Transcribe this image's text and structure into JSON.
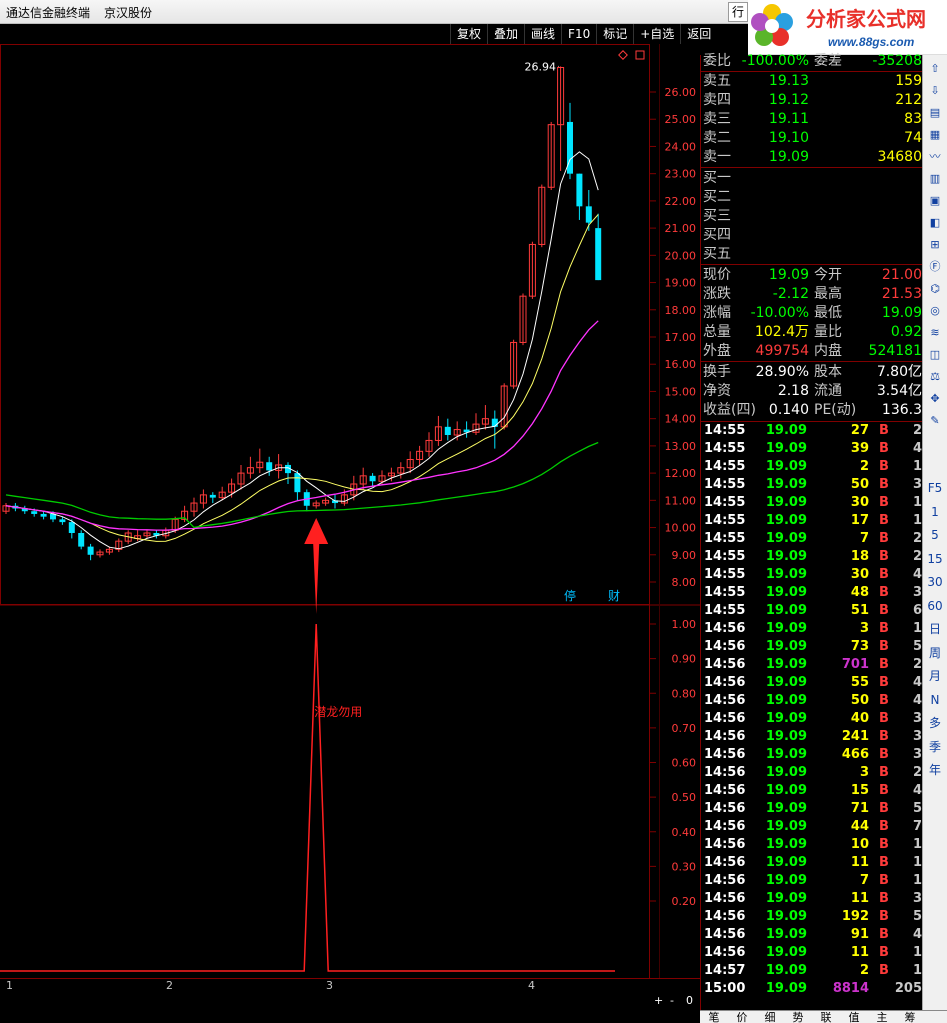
{
  "window": {
    "app_title": "通达信金融终端",
    "stock_name": "京汉股份",
    "menu_label": "行"
  },
  "logo": {
    "name": "分析家公式网",
    "url": "www.88gs.com"
  },
  "toolbar": [
    "复权",
    "叠加",
    "画线",
    "F10",
    "标记",
    "+自选",
    "返回"
  ],
  "chart": {
    "y_ticks": [
      "26.00",
      "25.00",
      "24.00",
      "23.00",
      "22.00",
      "21.00",
      "20.00",
      "19.00",
      "18.00",
      "17.00",
      "16.00",
      "15.00",
      "14.00",
      "13.00",
      "12.00",
      "11.00",
      "10.00",
      "9.00",
      "8.00"
    ],
    "y_values": [
      26,
      25,
      24,
      23,
      22,
      21,
      20,
      19,
      18,
      17,
      16,
      15,
      14,
      13,
      12,
      11,
      10,
      9,
      8
    ],
    "peak_label": "26.94",
    "peak_value": 26.94,
    "badges": [
      "停",
      "财"
    ],
    "ind_ticks": [
      "1.00",
      "0.90",
      "0.80",
      "0.70",
      "0.60",
      "0.50",
      "0.40",
      "0.30",
      "0.20"
    ],
    "ind_values": [
      1.0,
      0.9,
      0.8,
      0.7,
      0.6,
      0.5,
      0.4,
      0.3,
      0.2
    ],
    "signal_label": "潜龙勿用",
    "date_labels": [
      "1",
      "2",
      "3",
      "4"
    ],
    "colors": {
      "up": "#ff3b3b",
      "down": "#00e5ff",
      "ma5": "#ffffff",
      "ma10": "#ffff66",
      "ma20": "#ff33ff",
      "ma60": "#00cc00",
      "grid": "#800000",
      "signal": "#ff2020"
    }
  },
  "zoom": {
    "plus": "+",
    "minus": "-",
    "value": "0"
  },
  "quote": {
    "weibi": {
      "label": "委比",
      "value": "-100.00%",
      "label2": "委差",
      "value2": "-35208"
    },
    "asks": [
      {
        "label": "卖五",
        "price": "19.13",
        "vol": "159"
      },
      {
        "label": "卖四",
        "price": "19.12",
        "vol": "212"
      },
      {
        "label": "卖三",
        "price": "19.11",
        "vol": "83"
      },
      {
        "label": "卖二",
        "price": "19.10",
        "vol": "74"
      },
      {
        "label": "卖一",
        "price": "19.09",
        "vol": "34680"
      }
    ],
    "bids": [
      "买一",
      "买二",
      "买三",
      "买四",
      "买五"
    ],
    "stats": [
      {
        "l1": "现价",
        "v1": "19.09",
        "c1": "#00ff00",
        "l2": "今开",
        "v2": "21.00",
        "c2": "#ff3b3b"
      },
      {
        "l1": "涨跌",
        "v1": "-2.12",
        "c1": "#00ff00",
        "l2": "最高",
        "v2": "21.53",
        "c2": "#ff3b3b"
      },
      {
        "l1": "涨幅",
        "v1": "-10.00%",
        "c1": "#00ff00",
        "l2": "最低",
        "v2": "19.09",
        "c2": "#00ff00"
      },
      {
        "l1": "总量",
        "v1": "102.4万",
        "c1": "#ffff00",
        "l2": "量比",
        "v2": "0.92",
        "c2": "#00ff00"
      },
      {
        "l1": "外盘",
        "v1": "499754",
        "c1": "#ff3b3b",
        "l2": "内盘",
        "v2": "524181",
        "c2": "#00ff00"
      }
    ],
    "stats2": [
      {
        "l1": "换手",
        "v1": "28.90%",
        "l2": "股本",
        "v2": "7.80亿"
      },
      {
        "l1": "净资",
        "v1": "2.18",
        "l2": "流通",
        "v2": "3.54亿"
      },
      {
        "l1": "收益(四)",
        "v1": "0.140",
        "l2": "PE(动)",
        "v2": "136.3"
      }
    ]
  },
  "ticks": [
    {
      "t": "14:55",
      "p": "19.09",
      "n": "27",
      "nc": "#ffff00",
      "b": "B",
      "c": "2"
    },
    {
      "t": "14:55",
      "p": "19.09",
      "n": "39",
      "nc": "#ffff00",
      "b": "B",
      "c": "4"
    },
    {
      "t": "14:55",
      "p": "19.09",
      "n": "2",
      "nc": "#ffff00",
      "b": "B",
      "c": "1"
    },
    {
      "t": "14:55",
      "p": "19.09",
      "n": "50",
      "nc": "#ffff00",
      "b": "B",
      "c": "3"
    },
    {
      "t": "14:55",
      "p": "19.09",
      "n": "30",
      "nc": "#ffff00",
      "b": "B",
      "c": "1"
    },
    {
      "t": "14:55",
      "p": "19.09",
      "n": "17",
      "nc": "#ffff00",
      "b": "B",
      "c": "1"
    },
    {
      "t": "14:55",
      "p": "19.09",
      "n": "7",
      "nc": "#ffff00",
      "b": "B",
      "c": "2"
    },
    {
      "t": "14:55",
      "p": "19.09",
      "n": "18",
      "nc": "#ffff00",
      "b": "B",
      "c": "2"
    },
    {
      "t": "14:55",
      "p": "19.09",
      "n": "30",
      "nc": "#ffff00",
      "b": "B",
      "c": "4"
    },
    {
      "t": "14:55",
      "p": "19.09",
      "n": "48",
      "nc": "#ffff00",
      "b": "B",
      "c": "3"
    },
    {
      "t": "14:55",
      "p": "19.09",
      "n": "51",
      "nc": "#ffff00",
      "b": "B",
      "c": "6"
    },
    {
      "t": "14:56",
      "p": "19.09",
      "n": "3",
      "nc": "#ffff00",
      "b": "B",
      "c": "1"
    },
    {
      "t": "14:56",
      "p": "19.09",
      "n": "73",
      "nc": "#ffff00",
      "b": "B",
      "c": "5"
    },
    {
      "t": "14:56",
      "p": "19.09",
      "n": "701",
      "nc": "#cc33cc",
      "b": "B",
      "c": "2"
    },
    {
      "t": "14:56",
      "p": "19.09",
      "n": "55",
      "nc": "#ffff00",
      "b": "B",
      "c": "4"
    },
    {
      "t": "14:56",
      "p": "19.09",
      "n": "50",
      "nc": "#ffff00",
      "b": "B",
      "c": "4"
    },
    {
      "t": "14:56",
      "p": "19.09",
      "n": "40",
      "nc": "#ffff00",
      "b": "B",
      "c": "3"
    },
    {
      "t": "14:56",
      "p": "19.09",
      "n": "241",
      "nc": "#ffff00",
      "b": "B",
      "c": "3"
    },
    {
      "t": "14:56",
      "p": "19.09",
      "n": "466",
      "nc": "#ffff00",
      "b": "B",
      "c": "3"
    },
    {
      "t": "14:56",
      "p": "19.09",
      "n": "3",
      "nc": "#ffff00",
      "b": "B",
      "c": "2"
    },
    {
      "t": "14:56",
      "p": "19.09",
      "n": "15",
      "nc": "#ffff00",
      "b": "B",
      "c": "4"
    },
    {
      "t": "14:56",
      "p": "19.09",
      "n": "71",
      "nc": "#ffff00",
      "b": "B",
      "c": "5"
    },
    {
      "t": "14:56",
      "p": "19.09",
      "n": "44",
      "nc": "#ffff00",
      "b": "B",
      "c": "7"
    },
    {
      "t": "14:56",
      "p": "19.09",
      "n": "10",
      "nc": "#ffff00",
      "b": "B",
      "c": "1"
    },
    {
      "t": "14:56",
      "p": "19.09",
      "n": "11",
      "nc": "#ffff00",
      "b": "B",
      "c": "1"
    },
    {
      "t": "14:56",
      "p": "19.09",
      "n": "7",
      "nc": "#ffff00",
      "b": "B",
      "c": "1"
    },
    {
      "t": "14:56",
      "p": "19.09",
      "n": "11",
      "nc": "#ffff00",
      "b": "B",
      "c": "3"
    },
    {
      "t": "14:56",
      "p": "19.09",
      "n": "192",
      "nc": "#ffff00",
      "b": "B",
      "c": "5"
    },
    {
      "t": "14:56",
      "p": "19.09",
      "n": "91",
      "nc": "#ffff00",
      "b": "B",
      "c": "4"
    },
    {
      "t": "14:56",
      "p": "19.09",
      "n": "11",
      "nc": "#ffff00",
      "b": "B",
      "c": "1"
    },
    {
      "t": "14:57",
      "p": "19.09",
      "n": "2",
      "nc": "#ffff00",
      "b": "B",
      "c": "1"
    },
    {
      "t": "15:00",
      "p": "19.09",
      "n": "8814",
      "nc": "#cc33cc",
      "b": "",
      "c": "205"
    }
  ],
  "side_icons": [
    "F5",
    "1",
    "5",
    "15",
    "30",
    "60",
    "日",
    "周",
    "月",
    "N",
    "多",
    "季",
    "年"
  ],
  "bottom_tabs": [
    "笔",
    "价",
    "细",
    "势",
    "联",
    "值",
    "主",
    "筹"
  ]
}
